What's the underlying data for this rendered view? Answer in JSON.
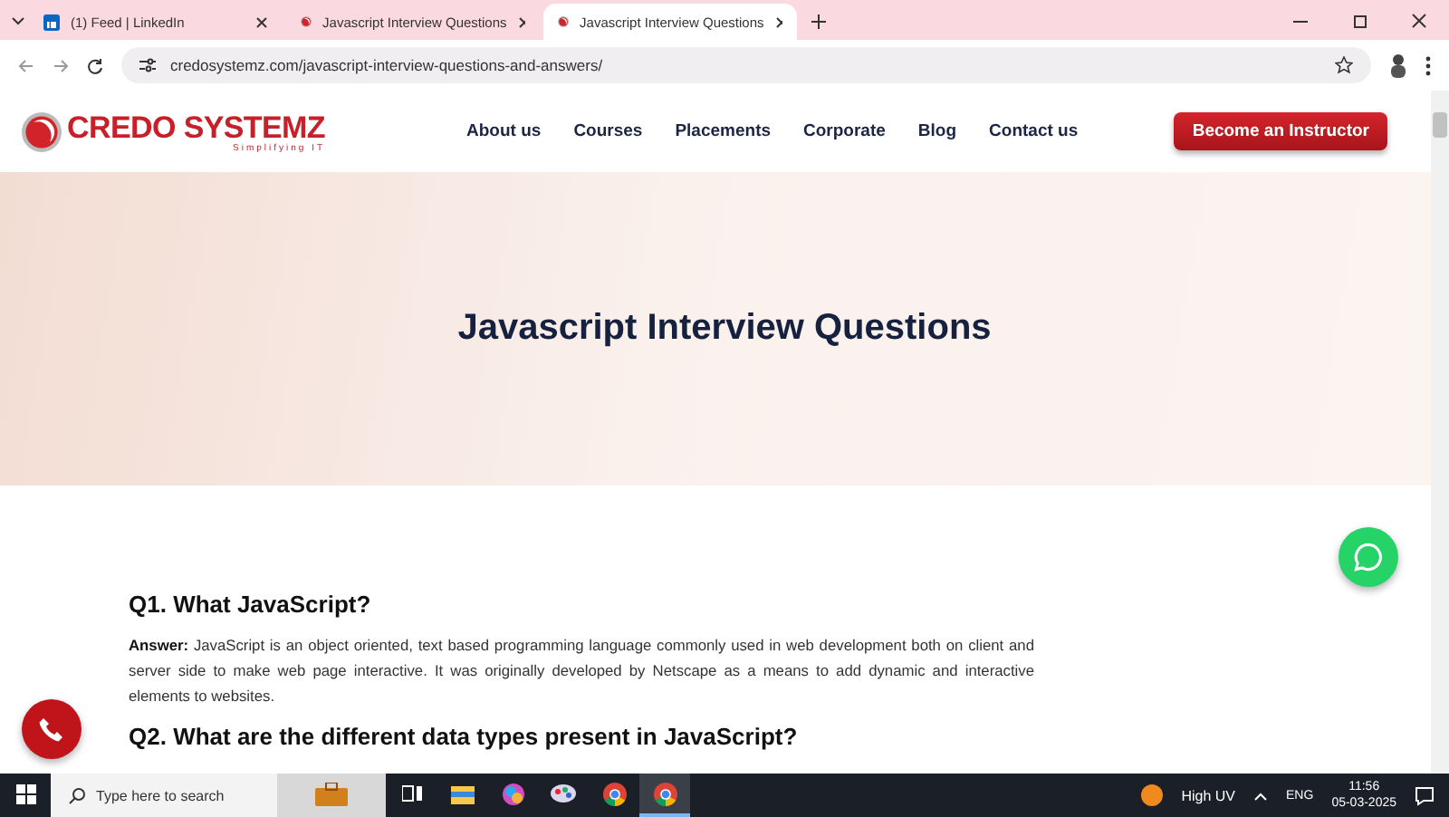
{
  "browser": {
    "tabs": [
      {
        "title": "(1) Feed | LinkedIn",
        "kind": "linkedin",
        "selected": false
      },
      {
        "title": "Javascript Interview Questions",
        "kind": "credo",
        "selected": false
      },
      {
        "title": "Javascript Interview Questions",
        "kind": "credo",
        "selected": true
      }
    ],
    "url": "credosystemz.com/javascript-interview-questions-and-answers/"
  },
  "site": {
    "logo": {
      "name": "CREDO SYSTEMZ",
      "tagline": "Simplifying IT"
    },
    "nav": [
      "About us",
      "Courses",
      "Placements",
      "Corporate",
      "Blog",
      "Contact us"
    ],
    "cta": "Become an Instructor",
    "hero_title": "Javascript Interview Questions",
    "questions": [
      {
        "title": "Q1. What JavaScript?",
        "answer": "**Answer:** JavaScript is an object oriented, text based programming language commonly used in web development both on client and server side to make web page interactive. It was originally developed by Netscape as a means to add dynamic and interactive elements to websites."
      },
      {
        "title": "Q2. What are the different data types present in JavaScript?"
      }
    ]
  },
  "taskbar": {
    "search_placeholder": "Type here to search",
    "weather": "High UV",
    "language": "ENG",
    "time": "11:56",
    "date": "05-03-2025",
    "apps": [
      {
        "kind": "taskview",
        "selected": false
      },
      {
        "kind": "files",
        "selected": false
      },
      {
        "kind": "copilot",
        "selected": false
      },
      {
        "kind": "paint",
        "selected": false
      },
      {
        "kind": "chrome",
        "selected": false
      },
      {
        "kind": "chrome",
        "selected": true
      }
    ]
  }
}
